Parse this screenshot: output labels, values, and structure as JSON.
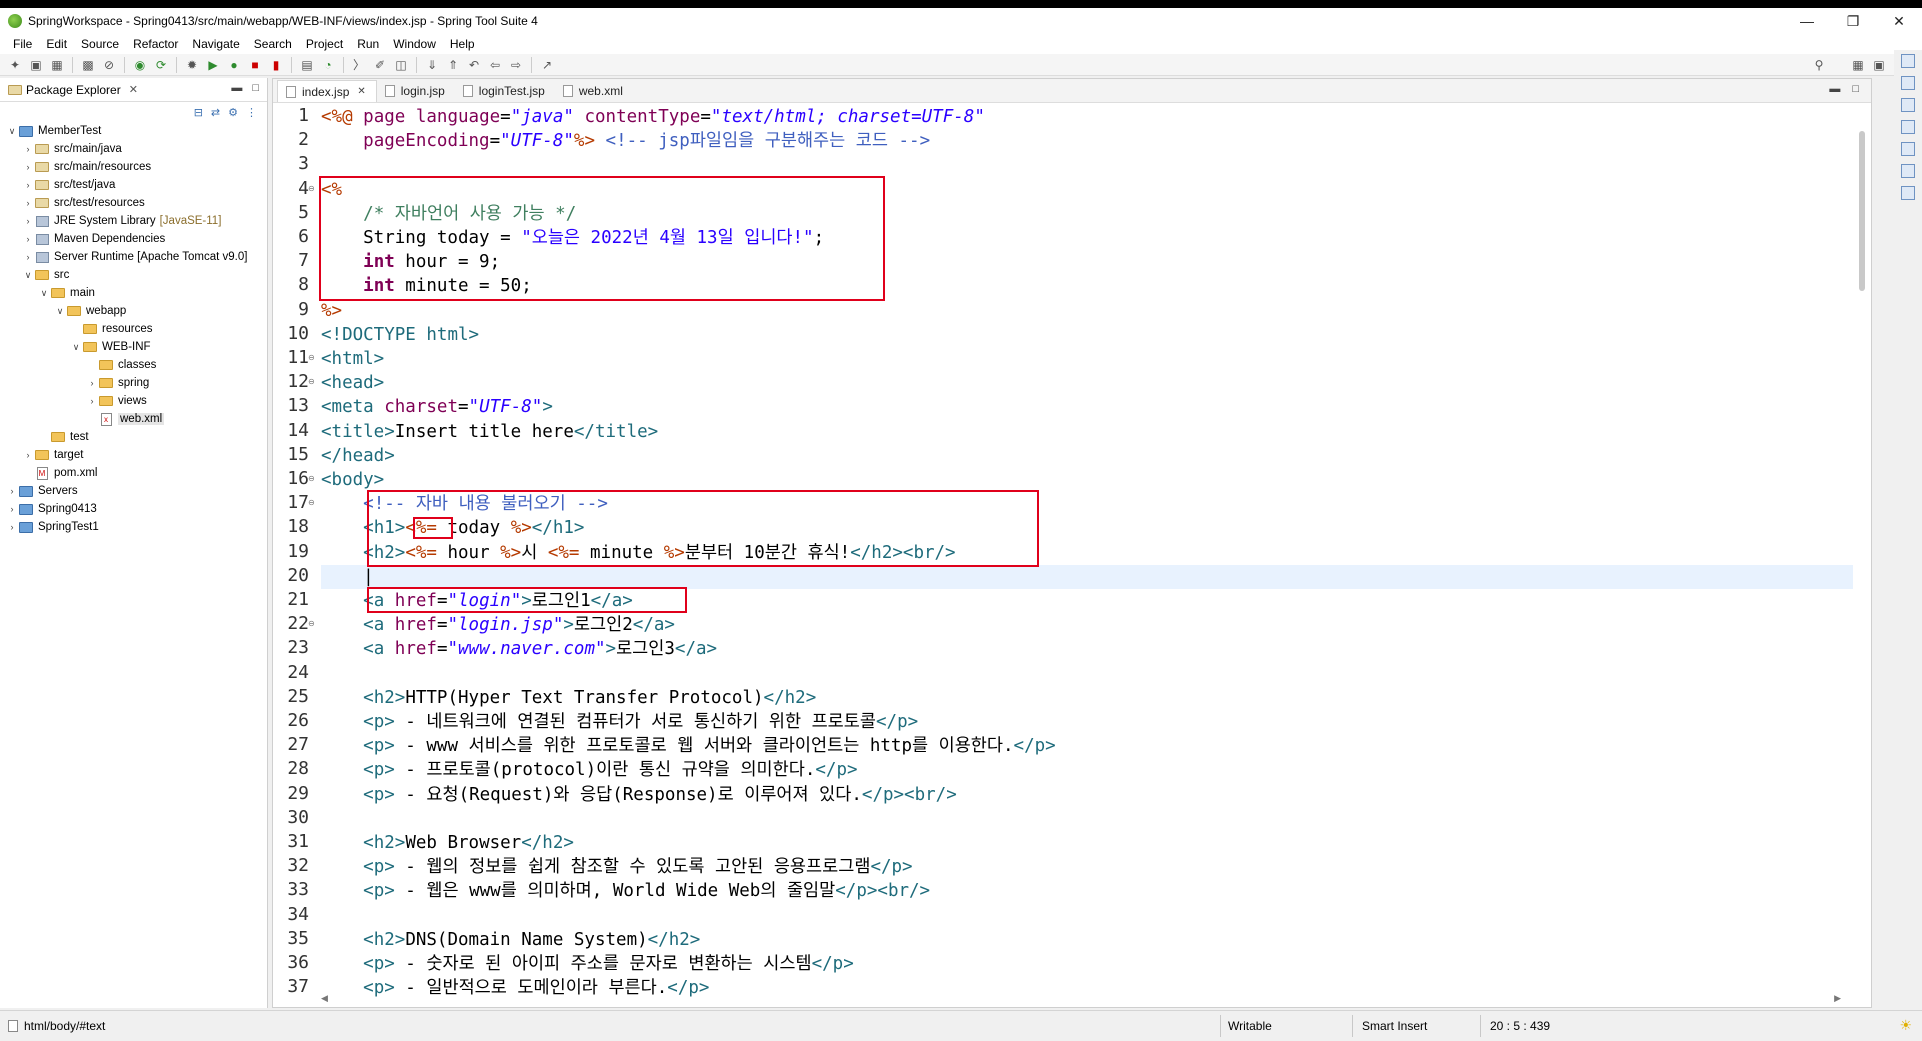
{
  "window": {
    "title": "SpringWorkspace - Spring0413/src/main/webapp/WEB-INF/views/index.jsp - Spring Tool Suite 4"
  },
  "menu": [
    "File",
    "Edit",
    "Source",
    "Refactor",
    "Navigate",
    "Search",
    "Project",
    "Run",
    "Window",
    "Help"
  ],
  "package_explorer": {
    "title": "Package Explorer",
    "tree": [
      {
        "label": "MemberTest",
        "depth": 0,
        "icon": "project-icon",
        "twisty": "open"
      },
      {
        "label": "src/main/java",
        "depth": 1,
        "icon": "source-folder-icon",
        "twisty": "closed"
      },
      {
        "label": "src/main/resources",
        "depth": 1,
        "icon": "source-folder-icon",
        "twisty": "closed"
      },
      {
        "label": "src/test/java",
        "depth": 1,
        "icon": "source-folder-icon",
        "twisty": "closed"
      },
      {
        "label": "src/test/resources",
        "depth": 1,
        "icon": "source-folder-icon",
        "twisty": "closed"
      },
      {
        "label": "JRE System Library",
        "extra": "[JavaSE-11]",
        "depth": 1,
        "icon": "library-icon",
        "twisty": "closed"
      },
      {
        "label": "Maven Dependencies",
        "depth": 1,
        "icon": "library-icon",
        "twisty": "closed"
      },
      {
        "label": "Server Runtime [Apache Tomcat v9.0]",
        "depth": 1,
        "icon": "library-icon",
        "twisty": "closed"
      },
      {
        "label": "src",
        "depth": 1,
        "icon": "folder-icon",
        "twisty": "open"
      },
      {
        "label": "main",
        "depth": 2,
        "icon": "folder-icon",
        "twisty": "open"
      },
      {
        "label": "webapp",
        "depth": 3,
        "icon": "folder-icon",
        "twisty": "open"
      },
      {
        "label": "resources",
        "depth": 4,
        "icon": "folder-icon",
        "twisty": ""
      },
      {
        "label": "WEB-INF",
        "depth": 4,
        "icon": "folder-icon",
        "twisty": "open"
      },
      {
        "label": "classes",
        "depth": 5,
        "icon": "folder-icon",
        "twisty": ""
      },
      {
        "label": "spring",
        "depth": 5,
        "icon": "folder-icon",
        "twisty": "closed"
      },
      {
        "label": "views",
        "depth": 5,
        "icon": "folder-icon",
        "twisty": "closed"
      },
      {
        "label": "web.xml",
        "depth": 5,
        "icon": "xml-file-icon",
        "twisty": "",
        "selected": true
      },
      {
        "label": "test",
        "depth": 2,
        "icon": "folder-icon",
        "twisty": ""
      },
      {
        "label": "target",
        "depth": 1,
        "icon": "folder-icon",
        "twisty": "closed"
      },
      {
        "label": "pom.xml",
        "depth": 1,
        "icon": "pom-file-icon",
        "twisty": ""
      },
      {
        "label": "Servers",
        "depth": 0,
        "icon": "project-icon",
        "twisty": "closed"
      },
      {
        "label": "Spring0413",
        "depth": 0,
        "icon": "project-icon",
        "twisty": "closed"
      },
      {
        "label": "SpringTest1",
        "depth": 0,
        "icon": "project-icon",
        "twisty": "closed"
      }
    ]
  },
  "editor": {
    "tabs": [
      {
        "label": "index.jsp",
        "active": true,
        "closable": true
      },
      {
        "label": "login.jsp",
        "active": false
      },
      {
        "label": "loginTest.jsp",
        "active": false
      },
      {
        "label": "web.xml",
        "active": false
      }
    ],
    "lines": [
      {
        "n": "1",
        "html": "<span class='jsp'>&lt;%@</span> <span class='att'>page</span> <span class='att'>language</span>=<span class='str'>\"java\"</span> <span class='att'>contentType</span>=<span class='str'>\"text/html; charset=UTF-8\"</span>"
      },
      {
        "n": "2",
        "html": "    <span class='att'>pageEncoding</span>=<span class='str'>\"UTF-8\"</span><span class='jsp'>%&gt;</span> <span class='cmt'>&lt;!-- jsp파일임을 구분해주는 코드 --&gt;</span>"
      },
      {
        "n": "3",
        "html": ""
      },
      {
        "n": "4",
        "html": "<span class='jsp'>&lt;%</span>",
        "fold": true
      },
      {
        "n": "5",
        "html": "    <span class='cmt' style='font-style:normal;color:#3f7f5f'>/* 자바언어 사용 가능 */</span>"
      },
      {
        "n": "6",
        "html": "    String today = <span class='jstr'>\"오늘은 2022년 4월 13일 입니다!\"</span>;"
      },
      {
        "n": "7",
        "html": "    <span class='kw'>int</span> hour = 9;"
      },
      {
        "n": "8",
        "html": "    <span class='kw'>int</span> minute = 50;"
      },
      {
        "n": "9",
        "html": "<span class='jsp'>%&gt;</span>"
      },
      {
        "n": "10",
        "html": "<span class='tag'>&lt;!DOCTYPE</span> <span class='tag'>html&gt;</span>"
      },
      {
        "n": "11",
        "html": "<span class='tag'>&lt;html&gt;</span>",
        "fold": true
      },
      {
        "n": "12",
        "html": "<span class='tag'>&lt;head&gt;</span>",
        "fold": true
      },
      {
        "n": "13",
        "html": "<span class='tag'>&lt;meta</span> <span class='att'>charset</span>=<span class='str'>\"UTF-8\"</span><span class='tag'>&gt;</span>"
      },
      {
        "n": "14",
        "html": "<span class='tag'>&lt;title&gt;</span>Insert title here<span class='tag'>&lt;/title&gt;</span>"
      },
      {
        "n": "15",
        "html": "<span class='tag'>&lt;/head&gt;</span>"
      },
      {
        "n": "16",
        "html": "<span class='tag'>&lt;body&gt;</span>",
        "fold": true
      },
      {
        "n": "17",
        "html": "    <span class='cmt'>&lt;!-- 자바 내용 불러오기 --&gt;</span>",
        "fold": true
      },
      {
        "n": "18",
        "html": "    <span class='tag'>&lt;h1&gt;</span><span class='jsp'>&lt;%=</span> today <span class='jsp'>%&gt;</span><span class='tag'>&lt;/h1&gt;</span>"
      },
      {
        "n": "19",
        "html": "    <span class='tag'>&lt;h2&gt;</span><span class='jsp'>&lt;%=</span> hour <span class='jsp'>%&gt;</span>시 <span class='jsp'>&lt;%=</span> minute <span class='jsp'>%&gt;</span>분부터 10분간 휴식!<span class='tag'>&lt;/h2&gt;&lt;br/&gt;</span>"
      },
      {
        "n": "20",
        "html": "    |"
      },
      {
        "n": "21",
        "html": "    <span class='tag'>&lt;a</span> <span class='att'>href</span>=<span class='str'>\"login\"</span><span class='tag'>&gt;</span>로그인1<span class='tag'>&lt;/a&gt;</span>"
      },
      {
        "n": "22",
        "html": "    <span class='tag'>&lt;a</span> <span class='att'>href</span>=<span class='str'>\"login.jsp\"</span><span class='tag'>&gt;</span>로그인2<span class='tag'>&lt;/a&gt;</span>",
        "fold": true
      },
      {
        "n": "23",
        "html": "    <span class='tag'>&lt;a</span> <span class='att'>href</span>=<span class='str'>\"www.naver.com\"</span><span class='tag'>&gt;</span>로그인3<span class='tag'>&lt;/a&gt;</span>"
      },
      {
        "n": "24",
        "html": ""
      },
      {
        "n": "25",
        "html": "    <span class='tag'>&lt;h2&gt;</span>HTTP(Hyper Text Transfer Protocol)<span class='tag'>&lt;/h2&gt;</span>"
      },
      {
        "n": "26",
        "html": "    <span class='tag'>&lt;p&gt;</span> - 네트워크에 연결된 컴퓨터가 서로 통신하기 위한 프로토콜<span class='tag'>&lt;/p&gt;</span>"
      },
      {
        "n": "27",
        "html": "    <span class='tag'>&lt;p&gt;</span> - www 서비스를 위한 프로토콜로 웹 서버와 클라이언트는 http를 이용한다.<span class='tag'>&lt;/p&gt;</span>"
      },
      {
        "n": "28",
        "html": "    <span class='tag'>&lt;p&gt;</span> - 프로토콜(protocol)이란 통신 규약을 의미한다.<span class='tag'>&lt;/p&gt;</span>"
      },
      {
        "n": "29",
        "html": "    <span class='tag'>&lt;p&gt;</span> - 요청(Request)와 응답(Response)로 이루어져 있다.<span class='tag'>&lt;/p&gt;&lt;br/&gt;</span>"
      },
      {
        "n": "30",
        "html": ""
      },
      {
        "n": "31",
        "html": "    <span class='tag'>&lt;h2&gt;</span>Web Browser<span class='tag'>&lt;/h2&gt;</span>"
      },
      {
        "n": "32",
        "html": "    <span class='tag'>&lt;p&gt;</span> - 웹의 정보를 쉽게 참조할 수 있도록 고안된 응용프로그램<span class='tag'>&lt;/p&gt;</span>"
      },
      {
        "n": "33",
        "html": "    <span class='tag'>&lt;p&gt;</span> - 웹은 www를 의미하며, World Wide Web의 줄임말<span class='tag'>&lt;/p&gt;&lt;br/&gt;</span>"
      },
      {
        "n": "34",
        "html": ""
      },
      {
        "n": "35",
        "html": "    <span class='tag'>&lt;h2&gt;</span>DNS(Domain Name System)<span class='tag'>&lt;/h2&gt;</span>"
      },
      {
        "n": "36",
        "html": "    <span class='tag'>&lt;p&gt;</span> - 숫자로 된 아이피 주소를 문자로 변환하는 시스템<span class='tag'>&lt;/p&gt;</span>"
      },
      {
        "n": "37",
        "html": "    <span class='tag'>&lt;p&gt;</span> - 일반적으로 도메인이라 부른다.<span class='tag'>&lt;/p&gt;</span>"
      }
    ]
  },
  "status": {
    "path": "html/body/#text",
    "mode": "Writable",
    "insert": "Smart Insert",
    "position": "20 : 5 : 439"
  },
  "colors": {
    "highlight_box": "#e0001b",
    "current_line": "#e8f2fe"
  }
}
